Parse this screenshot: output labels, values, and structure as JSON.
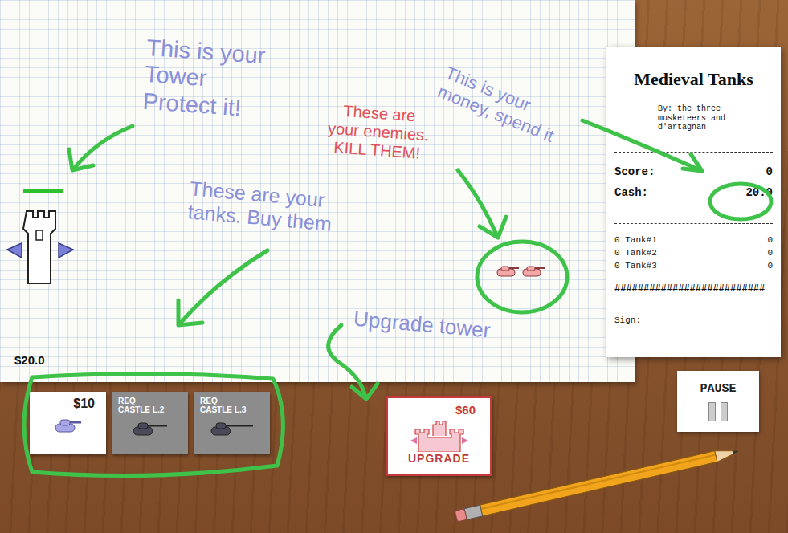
{
  "game": {
    "title": "Medieval Tanks",
    "credits": "By: the three musketeers and d'artagnan"
  },
  "notes": [
    {
      "lines": [
        "This is your",
        "Tower",
        "Protect it!"
      ],
      "color": "#8a90d8"
    },
    {
      "lines": [
        "These are",
        "your enemies.",
        "KILL THEM!"
      ],
      "color": "#e0505a"
    },
    {
      "lines": [
        "This is your",
        "money, spend it"
      ],
      "color": "#8a90d8"
    },
    {
      "lines": [
        "These are your",
        "tanks. Buy them"
      ],
      "color": "#8a90d8"
    },
    {
      "lines": [
        "Upgrade tower"
      ],
      "color": "#8a90d8"
    }
  ],
  "tower": {
    "health": 1.0
  },
  "enemies": [
    {
      "kind": "tank"
    },
    {
      "kind": "tank"
    }
  ],
  "money": "$20.0",
  "receipt": {
    "score_label": "Score:",
    "score": "0",
    "cash_label": "Cash:",
    "cash": "20.0",
    "tanks": [
      {
        "count": "0",
        "name": "Tank#1",
        "value": "0"
      },
      {
        "count": "0",
        "name": "Tank#2",
        "value": "0"
      },
      {
        "count": "0",
        "name": "Tank#3",
        "value": "0"
      }
    ],
    "divider": "##########################",
    "sign_label": "Sign:"
  },
  "shop": [
    {
      "price": "$10",
      "req": "",
      "label": "",
      "locked": false
    },
    {
      "price": "",
      "req": "REQ",
      "label": "CASTLE L.2",
      "locked": true
    },
    {
      "price": "",
      "req": "REQ",
      "label": "CASTLE L.3",
      "locked": true
    }
  ],
  "upgrade": {
    "price": "$60",
    "label": "UPGRADE"
  },
  "pause": {
    "label": "PAUSE"
  }
}
